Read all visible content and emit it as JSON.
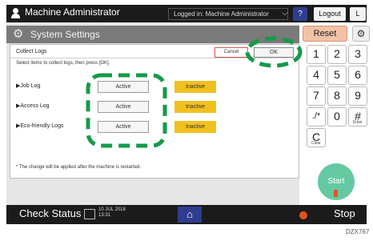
{
  "topbar": {
    "title": "Machine Administrator",
    "logged_in": "Logged in: Machine Administrator",
    "chevron": "⌵",
    "help": "?",
    "logout": "Logout",
    "extra": "L"
  },
  "header": {
    "title": "System Settings",
    "gear": "⚙"
  },
  "dialog": {
    "title": "Collect Logs",
    "instruction": "Select items to collect logs, then press [OK].",
    "cancel_label": "Cancel",
    "ok_label": "OK",
    "rows": [
      {
        "label": "▶Job Log",
        "active": "Active",
        "inactive": "Inactive"
      },
      {
        "label": "▶Access Log",
        "active": "Active",
        "inactive": "Inactive"
      },
      {
        "label": "▶Eco-friendly Logs",
        "active": "Active",
        "inactive": "Inactive"
      }
    ],
    "note": "* The change will be applied after the machine is restarted."
  },
  "keypad": {
    "reset": "Reset",
    "settings": "⚙",
    "keys": [
      {
        "main": "1",
        "sub": ""
      },
      {
        "main": "2",
        "sub": ""
      },
      {
        "main": "3",
        "sub": ""
      },
      {
        "main": "4",
        "sub": ""
      },
      {
        "main": "5",
        "sub": ""
      },
      {
        "main": "6",
        "sub": ""
      },
      {
        "main": "7",
        "sub": ""
      },
      {
        "main": "8",
        "sub": ""
      },
      {
        "main": "9",
        "sub": ""
      },
      {
        "main": "./*",
        "sub": ""
      },
      {
        "main": "0",
        "sub": ""
      },
      {
        "main": "#",
        "sub": "Enter"
      },
      {
        "main": "C",
        "sub": "Clear"
      }
    ],
    "start": "Start"
  },
  "bottombar": {
    "check_status": "Check Status",
    "date": "10 JUL 2018",
    "time": "13:31",
    "home": "⌂",
    "stop": "Stop"
  },
  "doc_code": "DZX767",
  "colors": {
    "highlight": "#159a4a",
    "inactive": "#f2c01e",
    "start": "#64c9a1",
    "reset": "#f3c2a6"
  }
}
